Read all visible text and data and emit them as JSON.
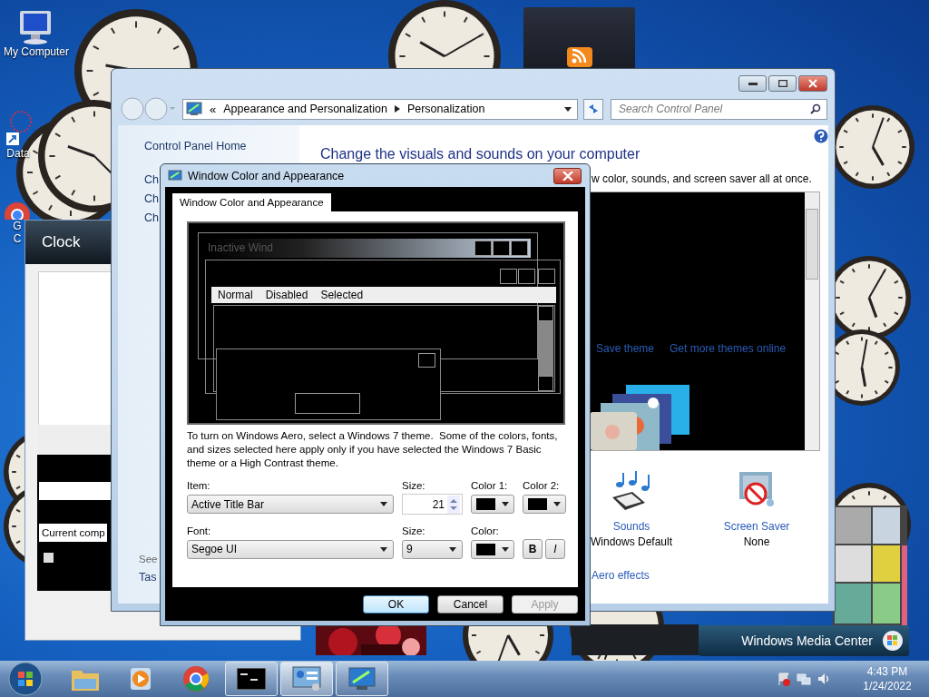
{
  "desktop_icons": [
    {
      "kind": "computer",
      "lines": [
        "My Computer"
      ]
    },
    {
      "kind": "shortcut",
      "lines": [
        "Data"
      ]
    },
    {
      "kind": "chrome",
      "lines": [
        "G",
        "C"
      ]
    }
  ],
  "clock_window": {
    "title": "Clock",
    "field_text": "Current comp",
    "checked": false
  },
  "control_panel": {
    "address": [
      "«",
      "Appearance and Personalization",
      "Personalization"
    ],
    "search": {
      "placeholder": "Search Control Panel"
    },
    "sidebar": {
      "home": "Control Panel Home",
      "links": [
        "Ch",
        "Ch",
        "Ch"
      ],
      "see_also": "See",
      "footer_links": [
        "Tas"
      ]
    },
    "heading": "Change the visuals and sounds on your computer",
    "subheading": "w color, sounds, and screen saver all at once.",
    "theme_links": [
      "Save theme",
      "Get more themes online"
    ],
    "settings": [
      {
        "kind": "sounds",
        "label": "Sounds",
        "value": "Windows Default"
      },
      {
        "kind": "screensaver",
        "label": "Screen Saver",
        "value": "None"
      }
    ],
    "aero_link": "Aero effects"
  },
  "dialog": {
    "title": "Window Color and Appearance",
    "tabs": [
      {
        "label": "Window Color and Appearance",
        "selected": true
      }
    ],
    "preview": {
      "inactive_title": "Inactive Wind",
      "menu": [
        "Normal",
        "Disabled",
        "Selected"
      ]
    },
    "description": "To turn on Windows Aero, select a Windows 7 theme.  Some of the colors, fonts, and sizes selected here apply only if you have selected the Windows 7 Basic theme or a High Contrast theme.",
    "item": {
      "label": "Item:",
      "value": "Active Title Bar"
    },
    "item_size": {
      "label": "Size:",
      "value": "21"
    },
    "color1": {
      "label": "Color 1:",
      "color": "#000000"
    },
    "color2": {
      "label": "Color 2:",
      "color": "#000000"
    },
    "font": {
      "label": "Font:",
      "value": "Segoe UI"
    },
    "font_size": {
      "label": "Size:",
      "value": "9"
    },
    "font_color": {
      "label": "Color:",
      "color": "#000000"
    },
    "bold": {
      "label": "B",
      "on": false
    },
    "italic": {
      "label": "I",
      "on": false
    },
    "buttons": [
      {
        "label": "OK",
        "kind": "default",
        "disabled": false
      },
      {
        "label": "Cancel",
        "kind": "normal",
        "disabled": false
      },
      {
        "label": "Apply",
        "kind": "normal",
        "disabled": true
      }
    ]
  },
  "media_center": {
    "label": "Windows Media Center"
  },
  "taskbar": {
    "apps": [
      {
        "kind": "explorer",
        "open": false,
        "selected": false
      },
      {
        "kind": "media",
        "open": false,
        "selected": false
      },
      {
        "kind": "chrome",
        "open": false,
        "selected": false
      },
      {
        "kind": "cmd",
        "open": true,
        "selected": false
      },
      {
        "kind": "control",
        "open": true,
        "selected": true
      },
      {
        "kind": "display",
        "open": true,
        "selected": false
      }
    ],
    "time": "4:43 PM",
    "date": "1/24/2022"
  }
}
